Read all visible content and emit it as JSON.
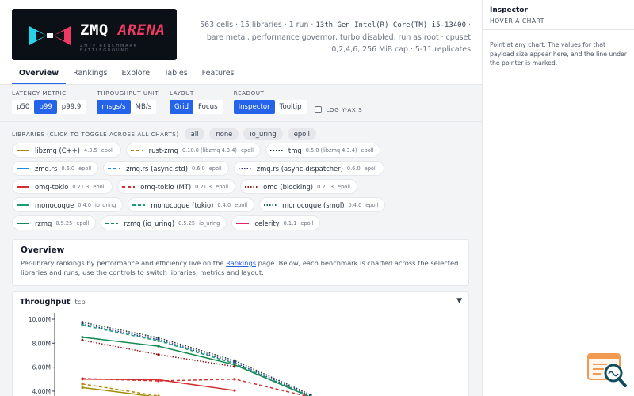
{
  "brand": {
    "name_a": "ZMQ ",
    "name_b": "ARENA",
    "tagline": "ZMTP BENCHMARK BATTLEGROUND"
  },
  "meta": {
    "line1_a": "563 cells · 15 libraries · 1 run · ",
    "cpu": "13th Gen Intel(R) Core(TM) i5-13400",
    "line1_b": " · bare metal, performance governor, turbo disabled, run as root · cpuset 0,2,4,6, 256 MiB cap · 5-11 replicates"
  },
  "tabs": [
    {
      "label": "Overview",
      "active": true
    },
    {
      "label": "Rankings",
      "active": false
    },
    {
      "label": "Explore",
      "active": false
    },
    {
      "label": "Tables",
      "active": false
    },
    {
      "label": "Features",
      "active": false
    }
  ],
  "controls": {
    "latency": {
      "label": "LATENCY METRIC",
      "options": [
        "p50",
        "p99",
        "p99.9"
      ],
      "selected": "p99"
    },
    "throughput": {
      "label": "THROUGHPUT UNIT",
      "options": [
        "msgs/s",
        "MB/s"
      ],
      "selected": "msgs/s"
    },
    "layout": {
      "label": "LAYOUT",
      "options": [
        "Grid",
        "Focus"
      ],
      "selected": "Grid"
    },
    "readout": {
      "label": "READOUT",
      "options": [
        "Inspector",
        "Tooltip"
      ],
      "selected": "Inspector"
    },
    "logy_label": "LOG Y-AXIS",
    "logy_checked": false
  },
  "libraries": {
    "label": "LIBRARIES (CLICK TO TOGGLE ACROSS ALL CHARTS)",
    "pills": [
      "all",
      "none",
      "io_uring",
      "epoll"
    ],
    "items": [
      {
        "name": "libzmq (C++)",
        "version": "4.3.5",
        "runtime": "epoll",
        "color": "#a08a00",
        "dash": "solid"
      },
      {
        "name": "rust-zmq",
        "version": "0.10.0 (libzmq 4.3.4)",
        "runtime": "epoll",
        "color": "#b8860b",
        "dash": "dash"
      },
      {
        "name": "tmq",
        "version": "0.5.0 (libzmq 4.3.4)",
        "runtime": "epoll",
        "color": "#1f3a2f",
        "dash": "dot"
      },
      {
        "name": "zmq.rs",
        "version": "0.6.0",
        "runtime": "epoll",
        "color": "#1e88e5",
        "dash": "solid"
      },
      {
        "name": "zmq.rs (async-std)",
        "version": "0.6.0",
        "runtime": "epoll",
        "color": "#1e88e5",
        "dash": "dash"
      },
      {
        "name": "zmq.rs (async-dispatcher)",
        "version": "0.6.0",
        "runtime": "epoll",
        "color": "#283593",
        "dash": "dot"
      },
      {
        "name": "omq-tokio",
        "version": "0.21.3",
        "runtime": "epoll",
        "color": "#d32f2f",
        "dash": "solid"
      },
      {
        "name": "omq-tokio (MT)",
        "version": "0.21.3",
        "runtime": "epoll",
        "color": "#d32f2f",
        "dash": "dash"
      },
      {
        "name": "omq (blocking)",
        "version": "0.21.3",
        "runtime": "epoll",
        "color": "#8b1a1a",
        "dash": "dot"
      },
      {
        "name": "monocoque",
        "version": "0.4.0",
        "runtime": "io_uring",
        "color": "#1b9e77",
        "dash": "solid"
      },
      {
        "name": "monocoque (tokio)",
        "version": "0.4.0",
        "runtime": "epoll",
        "color": "#1b9e77",
        "dash": "dash"
      },
      {
        "name": "monocoque (smol)",
        "version": "0.4.0",
        "runtime": "epoll",
        "color": "#1b5e50",
        "dash": "dot"
      },
      {
        "name": "rzmq",
        "version": "0.5.25",
        "runtime": "epoll",
        "color": "#138a4f",
        "dash": "solid"
      },
      {
        "name": "rzmq (io_uring)",
        "version": "0.5.25",
        "runtime": "io_uring",
        "color": "#138a4f",
        "dash": "dash"
      },
      {
        "name": "celerity",
        "version": "0.1.1",
        "runtime": "epoll",
        "color": "#e0245e",
        "dash": "solid"
      }
    ]
  },
  "overview": {
    "title": "Overview",
    "text_a": "Per-library rankings by performance and efficiency live on the ",
    "link": "Rankings",
    "text_b": " page. Below, each benchmark is charted across the selected libraries and runs; use the controls to switch libraries, metrics and layout."
  },
  "throughput_card": {
    "title": "Throughput",
    "subtitle": "tcp",
    "caret": "▼"
  },
  "chart_data": {
    "type": "line",
    "title": "Throughput",
    "subtitle": "tcp",
    "ylabel": "",
    "y_ticks": [
      "10.00M",
      "8.00M",
      "6.00M",
      "4.00M"
    ],
    "ylim_visible": [
      3.5,
      10.5
    ],
    "x_visible": [
      0,
      1,
      2,
      3
    ],
    "series": [
      {
        "name": "tmq",
        "color": "#1f3a2f",
        "dash": "dot",
        "points": [
          [
            0,
            9.75
          ],
          [
            1,
            8.45
          ],
          [
            2,
            6.55
          ],
          [
            3,
            3.7
          ]
        ]
      },
      {
        "name": "zmq.rs (async-dispatcher)",
        "color": "#283593",
        "dash": "dot",
        "points": [
          [
            0,
            9.6
          ],
          [
            1,
            8.3
          ],
          [
            2,
            6.4
          ],
          [
            3,
            3.6
          ]
        ]
      },
      {
        "name": "monocoque (tokio)",
        "color": "#1b9e77",
        "dash": "dash",
        "points": [
          [
            0,
            9.5
          ],
          [
            1,
            8.2
          ],
          [
            2,
            6.3
          ],
          [
            3,
            3.55
          ]
        ]
      },
      {
        "name": "rzmq",
        "color": "#138a4f",
        "dash": "solid",
        "points": [
          [
            0,
            8.5
          ],
          [
            1,
            7.75
          ],
          [
            2,
            6.2
          ],
          [
            3,
            3.5
          ]
        ]
      },
      {
        "name": "omq (blocking)",
        "color": "#8b1a1a",
        "dash": "dot",
        "points": [
          [
            0,
            8.25
          ],
          [
            1,
            7.05
          ],
          [
            2,
            6.05
          ]
        ]
      },
      {
        "name": "omq-tokio (MT)",
        "color": "#d32f2f",
        "dash": "dash",
        "points": [
          [
            0,
            5.05
          ],
          [
            1,
            4.85
          ],
          [
            2,
            5.0
          ],
          [
            3,
            3.5
          ]
        ]
      },
      {
        "name": "omq-tokio",
        "color": "#d32f2f",
        "dash": "solid",
        "points": [
          [
            0,
            5.0
          ],
          [
            1,
            4.95
          ],
          [
            2,
            4.05
          ]
        ]
      },
      {
        "name": "rust-zmq",
        "color": "#b8860b",
        "dash": "dash",
        "points": [
          [
            0,
            4.6
          ],
          [
            1,
            3.6
          ]
        ]
      },
      {
        "name": "libzmq (C++)",
        "color": "#a08a00",
        "dash": "solid",
        "points": [
          [
            0,
            4.3
          ],
          [
            1,
            3.5
          ]
        ]
      }
    ]
  },
  "inspector": {
    "title": "Inspector",
    "subtitle": "HOVER A CHART",
    "help": "Point at any chart. The values for that payload size appear here, and the line under the pointer is marked."
  }
}
